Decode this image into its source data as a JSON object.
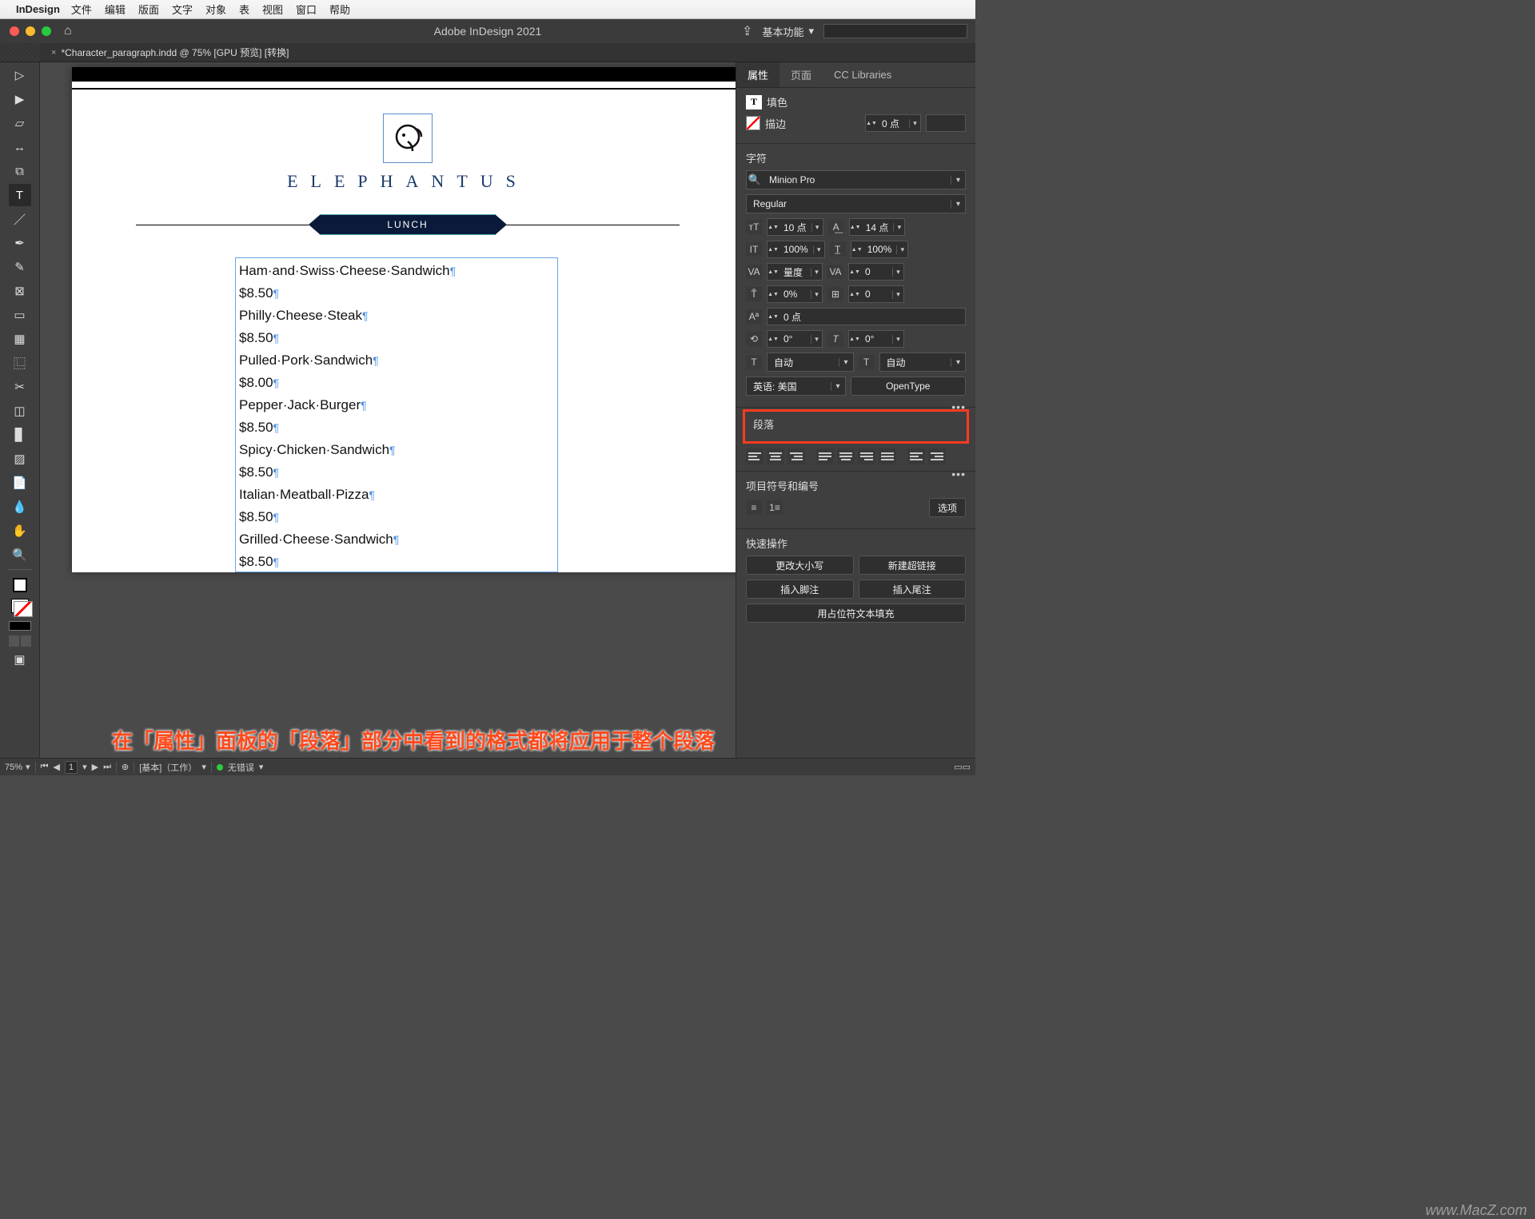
{
  "menubar": {
    "app": "InDesign",
    "items": [
      "文件",
      "编辑",
      "版面",
      "文字",
      "对象",
      "表",
      "视图",
      "窗口",
      "帮助"
    ]
  },
  "titlebar": {
    "title": "Adobe InDesign 2021",
    "workspace": "基本功能"
  },
  "doc_tab": {
    "label": "*Character_paragraph.indd @ 75% [GPU 预览] [转换]"
  },
  "document": {
    "brand": "ELEPHANTUS",
    "band": "LUNCH",
    "menu_items": [
      "Ham and Swiss Cheese Sandwich",
      "$8.50",
      "Philly Cheese Steak",
      "$8.50",
      "Pulled Pork Sandwich",
      "$8.00",
      "Pepper Jack Burger",
      "$8.50",
      "Spicy Chicken Sandwich",
      "$8.50",
      "Italian Meatball Pizza",
      "$8.50",
      "Grilled Cheese Sandwich",
      "$8.50"
    ]
  },
  "annotation": "在「属性」面板的「段落」部分中看到的格式都将应用于整个段落",
  "rpanel": {
    "tabs": {
      "properties": "属性",
      "pages": "页面",
      "cc": "CC Libraries"
    },
    "fill_label": "填色",
    "stroke_label": "描边",
    "stroke_weight": "0 点",
    "char": {
      "title": "字符",
      "font": "Minion Pro",
      "style": "Regular",
      "size": "10 点",
      "leading": "14 点",
      "hscale": "100%",
      "vscale": "100%",
      "kerning": "量度",
      "tracking": "0",
      "baseline": "0%",
      "baseline_shift_alt": "0",
      "baseline_pt": "0 点",
      "rotate": "0°",
      "skew": "0°",
      "auto1": "自动",
      "auto2": "自动",
      "lang": "英语: 美国",
      "opentype": "OpenType"
    },
    "paragraph": {
      "title": "段落"
    },
    "bullets": {
      "title": "项目符号和编号",
      "options": "选项"
    },
    "quick": {
      "title": "快速操作",
      "change_case": "更改大小写",
      "new_hyperlink": "新建超链接",
      "insert_footnote": "插入脚注",
      "insert_endnote": "插入尾注",
      "fill_placeholder": "用占位符文本填充"
    }
  },
  "statusbar": {
    "zoom": "75%",
    "page_label": "1",
    "layer": "[基本]（工作）",
    "errors": "无错误"
  },
  "watermark": "www.MacZ.com",
  "icon_labels": {
    "ham": "Ham·and·Swiss·Cheese·Sandwich"
  }
}
